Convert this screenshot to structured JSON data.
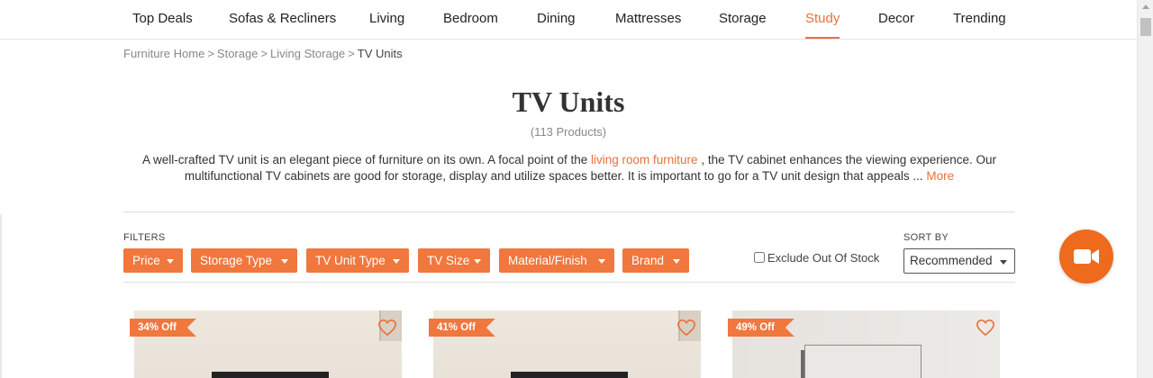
{
  "nav": {
    "items": [
      {
        "label": "Top Deals"
      },
      {
        "label": "Sofas & Recliners"
      },
      {
        "label": "Living"
      },
      {
        "label": "Bedroom"
      },
      {
        "label": "Dining"
      },
      {
        "label": "Mattresses"
      },
      {
        "label": "Storage"
      },
      {
        "label": "Study"
      },
      {
        "label": "Decor"
      },
      {
        "label": "Trending"
      }
    ],
    "active": "Study"
  },
  "breadcrumb": {
    "items": [
      "Furniture Home",
      "Storage",
      "Living Storage"
    ],
    "current": "TV Units",
    "separator": ">"
  },
  "page": {
    "title": "TV Units",
    "count": "(113 Products)",
    "description_part1": "A well-crafted TV unit is an elegant piece of furniture on its own. A focal point of the ",
    "description_link": "living room furniture",
    "description_part2": " , the TV cabinet enhances the viewing experience. Our multifunctional TV cabinets are good for storage, display and utilize spaces better. It is important to go for a TV unit design that appeals ... ",
    "more_label": "More"
  },
  "filters": {
    "label": "FILTERS",
    "buttons": [
      "Price",
      "Storage Type",
      "TV Unit Type",
      "TV Size",
      "Material/Finish",
      "Brand"
    ],
    "exclude_out_of_stock": "Exclude Out Of Stock",
    "exclude_checked": false
  },
  "sort": {
    "label": "SORT BY",
    "selected": "Recommended"
  },
  "products": [
    {
      "discount": "34% Off"
    },
    {
      "discount": "41% Off"
    },
    {
      "discount": "49% Off"
    }
  ],
  "colors": {
    "accent": "#f0773e",
    "video_button": "#ee6a1d",
    "active_nav": "#e8703a"
  },
  "icons": {
    "video": "video-camera-icon",
    "wishlist": "heart-icon",
    "dropdown": "chevron-down-icon"
  }
}
